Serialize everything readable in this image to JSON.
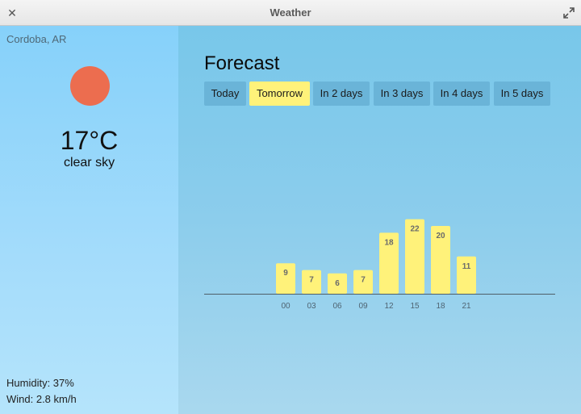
{
  "window": {
    "title": "Weather"
  },
  "current": {
    "location": "Cordoba, AR",
    "temperature": "17°C",
    "condition": "clear sky",
    "humidity": "Humidity: 37%",
    "wind": "Wind: 2.8 km/h",
    "sun_color": "#ec6d4f"
  },
  "forecast": {
    "title": "Forecast",
    "tabs": [
      {
        "label": "Today"
      },
      {
        "label": "Tomorrow",
        "active": true
      },
      {
        "label": "In 2 days"
      },
      {
        "label": "In 3 days"
      },
      {
        "label": "In 4 days"
      },
      {
        "label": "In 5 days"
      }
    ]
  },
  "chart_data": {
    "type": "bar",
    "categories": [
      "00",
      "03",
      "06",
      "09",
      "12",
      "15",
      "18",
      "21"
    ],
    "values": [
      9,
      7,
      6,
      7,
      18,
      22,
      20,
      11
    ],
    "bar_color": "#fff27a"
  },
  "colors": {
    "active_tab": "#fff27a",
    "inactive_tab": "#6ab4d8"
  }
}
